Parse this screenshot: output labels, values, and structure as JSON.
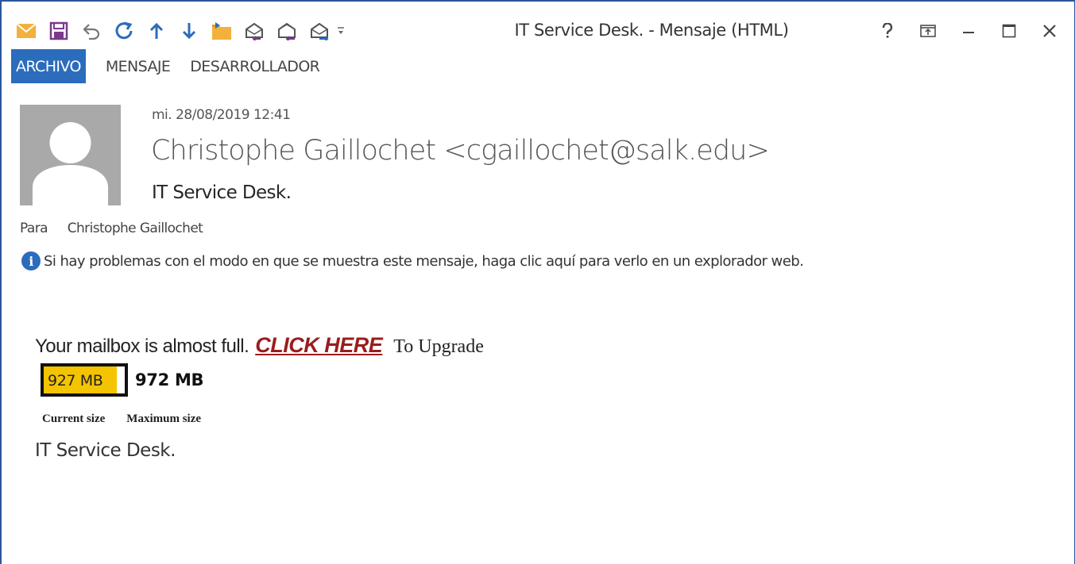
{
  "window": {
    "title": "IT Service Desk. - Mensaje (HTML)",
    "quick_access_icons": [
      "mail-icon",
      "save-icon",
      "undo-icon",
      "redo-icon",
      "previous-item-icon",
      "next-item-icon",
      "move-to-folder-icon",
      "reply-icon",
      "reply-all-icon",
      "forward-icon",
      "customize-toolbar-icon"
    ],
    "controls": [
      "help-icon",
      "ribbon-display-icon",
      "minimize-icon",
      "maximize-icon",
      "close-icon"
    ],
    "accent_color": "#2b579a"
  },
  "ribbon": {
    "tabs": [
      {
        "label": "ARCHIVO",
        "active": true
      },
      {
        "label": "MENSAJE",
        "active": false
      },
      {
        "label": "DESARROLLADOR",
        "active": false
      }
    ]
  },
  "message": {
    "date": "mi. 28/08/2019 12:41",
    "from": "Christophe Gaillochet <cgaillochet@salk.edu>",
    "subject": "IT Service Desk.",
    "to_label": "Para",
    "to_name": "Christophe Gaillochet",
    "info_text": "Si hay problemas con el modo en que se muestra este mensaje, haga clic aquí para verlo en un explorador web."
  },
  "body": {
    "lead": "Your mailbox is almost full.",
    "link": "CLICK HERE",
    "trail": "To Upgrade",
    "current_size": "927 MB",
    "maximum_size": "972 MB",
    "usage_fraction": 0.9,
    "usage_color": "#f5c400",
    "link_color": "#9b1c1c",
    "current_caption": "Current size",
    "maximum_caption": "Maximum size",
    "signature": "IT Service Desk."
  }
}
